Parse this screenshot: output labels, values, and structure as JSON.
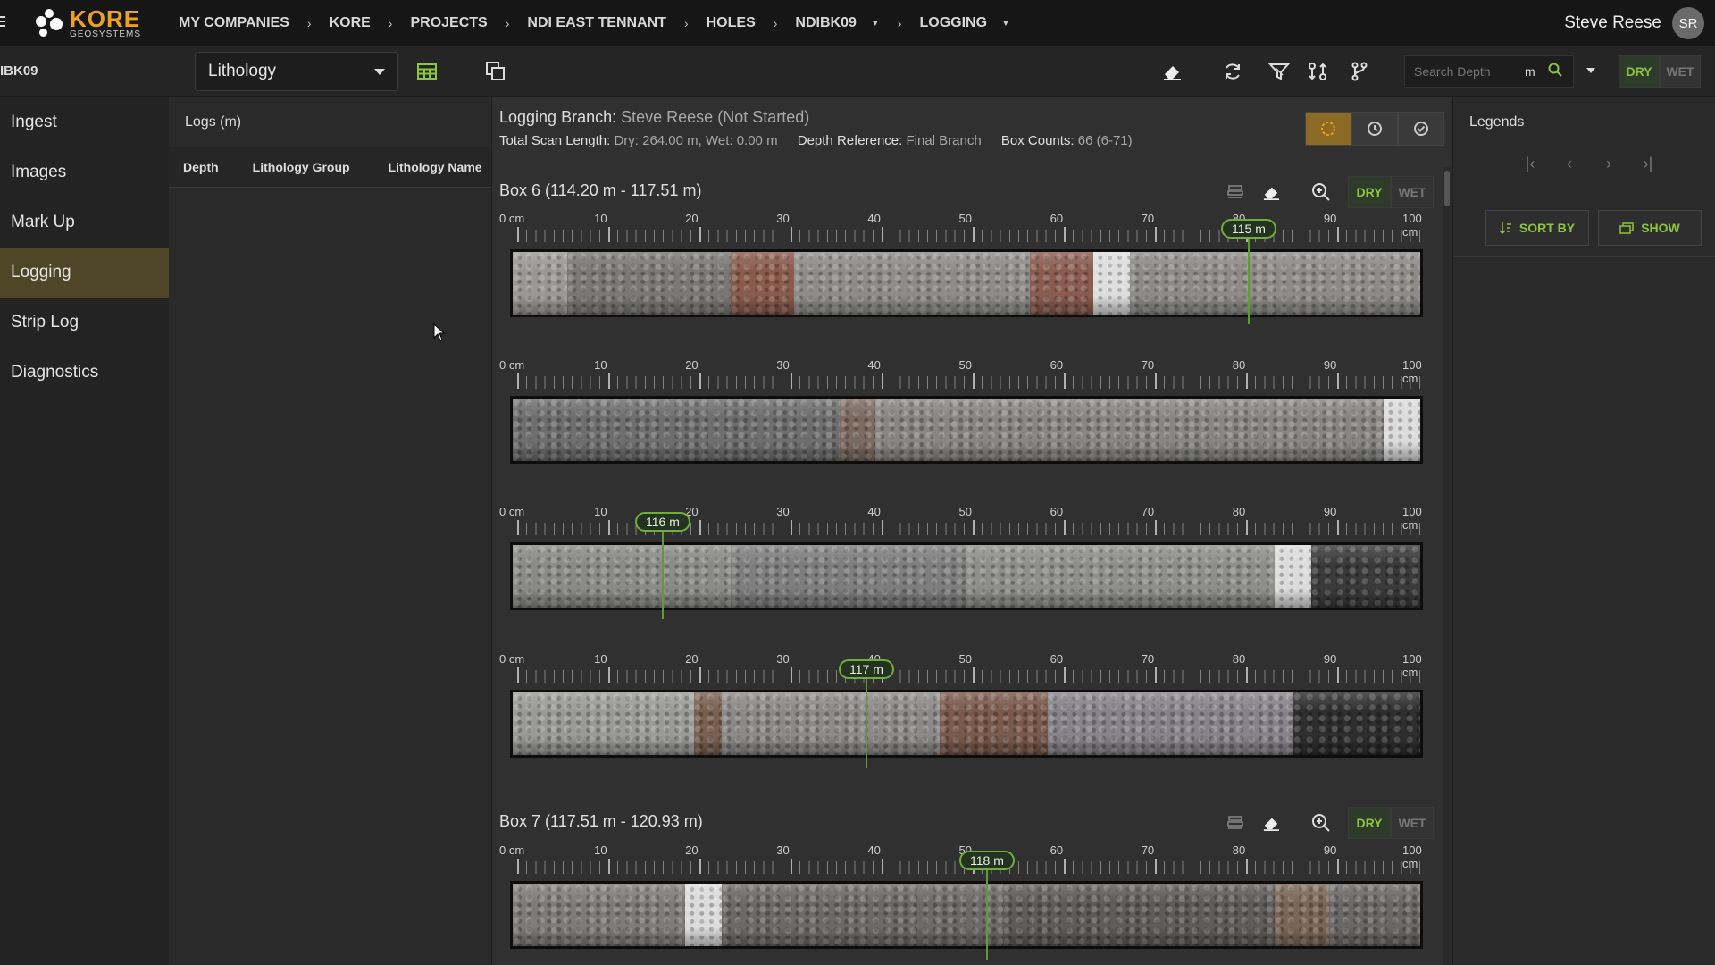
{
  "topbar": {
    "logo_name": "KORE",
    "logo_sub": "GEOSYSTEMS",
    "breadcrumb": [
      "MY COMPANIES",
      "KORE",
      "PROJECTS",
      "NDI EAST TENNANT",
      "HOLES",
      "NDIBK09",
      "LOGGING"
    ],
    "user_name": "Steve Reese",
    "user_initials": "SR"
  },
  "toolbar": {
    "hole_id": "IBK09",
    "lithology_select": "Lithology",
    "search_placeholder": "Search Depth",
    "search_unit": "m",
    "dry_label": "DRY",
    "wet_label": "WET"
  },
  "leftnav": {
    "items": [
      "Ingest",
      "Images",
      "Mark Up",
      "Logging",
      "Strip Log",
      "Diagnostics"
    ],
    "active": "Logging"
  },
  "logs": {
    "title": "Logs (m)",
    "columns": [
      "Depth",
      "Lithology Group",
      "Lithology Name"
    ]
  },
  "main": {
    "branch_label": "Logging Branch:",
    "branch_value": "Steve Reese",
    "branch_status": "(Not Started)",
    "scan_label": "Total Scan Length:",
    "scan_value": "Dry: 264.00 m, Wet: 0.00 m",
    "depth_ref_label": "Depth Reference:",
    "depth_ref_value": "Final Branch",
    "box_counts_label": "Box Counts:",
    "box_counts_value": "66 (6-71)",
    "ruler_labels": [
      "0 cm",
      "10",
      "20",
      "30",
      "40",
      "50",
      "60",
      "70",
      "80",
      "90",
      "100 cm"
    ],
    "boxes": [
      {
        "title": "Box 6 (114.20 m - 117.51 m)"
      },
      {
        "title": "Box 7 (117.51 m - 120.93 m)"
      }
    ],
    "markers": [
      "115 m",
      "116 m",
      "117 m",
      "118 m"
    ],
    "dry_label": "DRY",
    "wet_label": "WET"
  },
  "legends": {
    "title": "Legends",
    "sort_label": "SORT BY",
    "show_label": "SHOW"
  },
  "colors": {
    "accent_green": "#8cc63f",
    "logo_orange": "#f0a020",
    "active_nav": "#4f4628"
  }
}
